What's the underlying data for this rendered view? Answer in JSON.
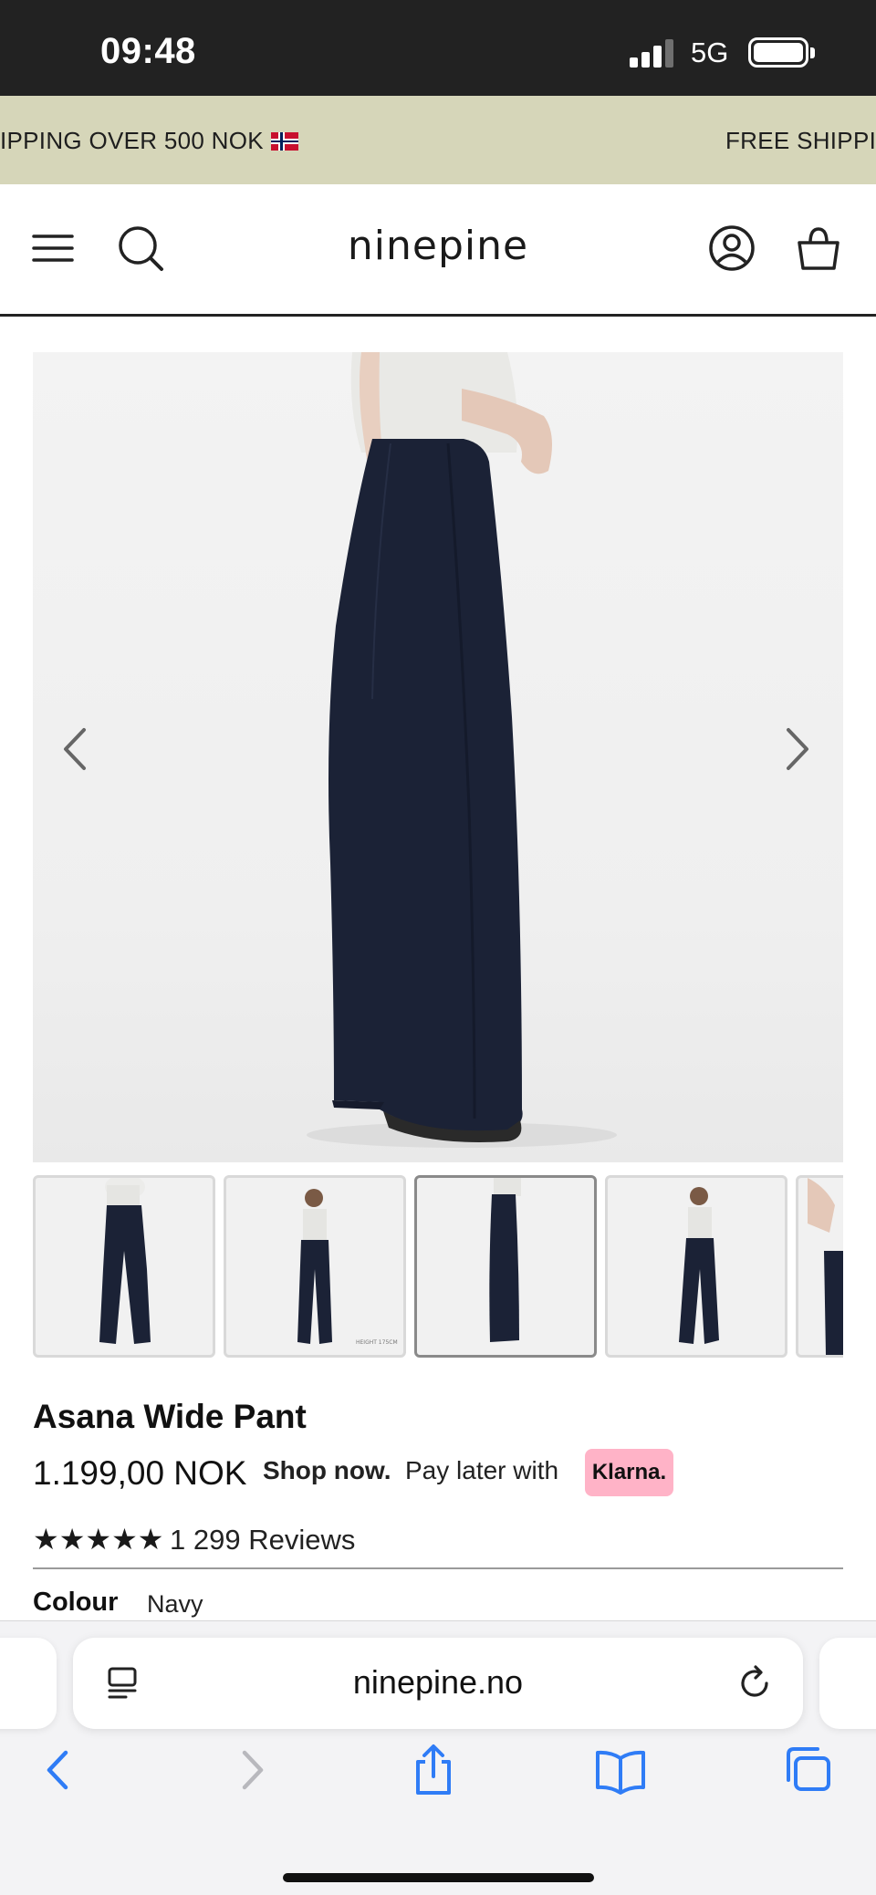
{
  "status_bar": {
    "time": "09:48",
    "network": "5G"
  },
  "announcement": {
    "text_partial": "IPPING OVER 500 NOK",
    "text_next": "FREE SHIPPI"
  },
  "header": {
    "logo": "ninepine"
  },
  "product": {
    "title": "Asana Wide Pant",
    "price": "1.199,00 NOK",
    "shop_now": "Shop now.",
    "pay_later": "Pay later with",
    "klarna": "Klarna.",
    "stars": "★★★★★",
    "reviews": "1 299 Reviews",
    "colour_label": "Colour",
    "colour_value": "Navy",
    "color_hex": "#1b2236",
    "thumbnail_count_visible": 5,
    "active_thumbnail_index": 3
  },
  "browser": {
    "url": "ninepine.no"
  },
  "colors": {
    "announcement_bg": "#d6d6b9",
    "klarna_pink": "#ffb3c7",
    "ios_blue": "#2f7cf6",
    "status_bar_bg": "#222222"
  }
}
